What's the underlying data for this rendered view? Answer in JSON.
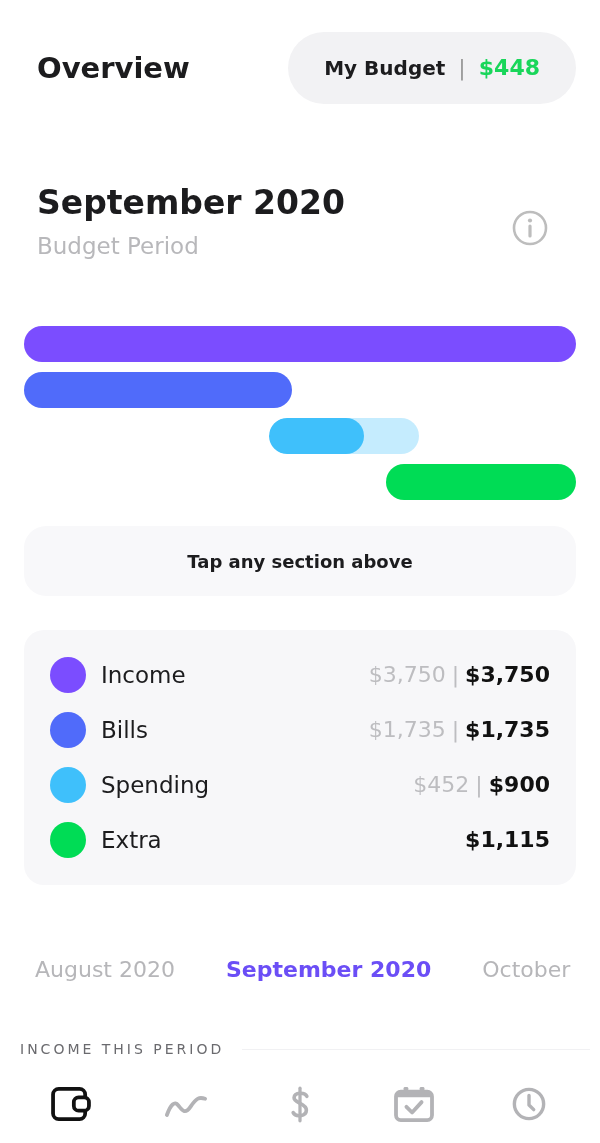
{
  "header": {
    "title": "Overview",
    "budget_label": "My Budget",
    "separator": "|",
    "budget_amount": "$448"
  },
  "period": {
    "title": "September 2020",
    "subtitle": "Budget Period"
  },
  "bars": [
    {
      "color": "#7b4dff"
    },
    {
      "color": "#506bfa"
    },
    {
      "color": "#3fc0fb",
      "level": 0.63
    },
    {
      "color": "#00dc55"
    }
  ],
  "hint": "Tap any section above",
  "legend": [
    {
      "name": "Income",
      "color": "#7b4dff",
      "spent": "$3,750",
      "separator": "|",
      "budgeted": "$3,750"
    },
    {
      "name": "Bills",
      "color": "#506bfa",
      "spent": "$1,735",
      "separator": "|",
      "budgeted": "$1,735"
    },
    {
      "name": "Spending",
      "color": "#3fc0fb",
      "spent": "$452",
      "separator": "|",
      "budgeted": "$900"
    },
    {
      "name": "Extra",
      "color": "#00dc55",
      "budgeted": "$1,115"
    }
  ],
  "period_tabs": [
    {
      "label": "August 2020",
      "selected": false
    },
    {
      "label": "September 2020",
      "selected": true
    },
    {
      "label": "October",
      "selected": false
    }
  ],
  "section_label": "INCOME THIS PERIOD",
  "nav": [
    {
      "selected": true
    },
    {
      "selected": false
    },
    {
      "selected": false
    },
    {
      "selected": false
    },
    {
      "selected": false
    }
  ]
}
